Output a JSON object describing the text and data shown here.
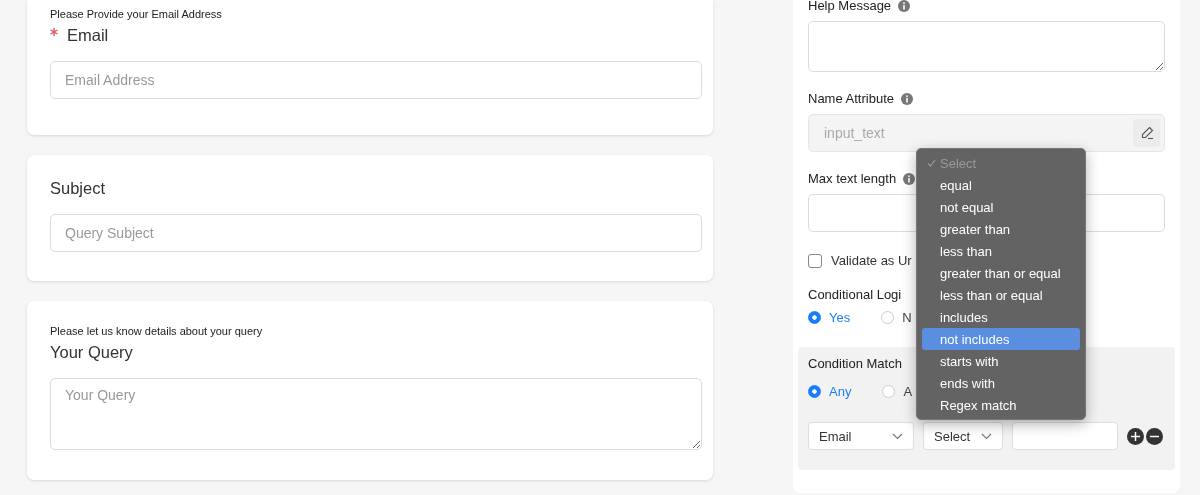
{
  "form_cards": [
    {
      "description": "Please Provide your Email Address",
      "label": "Email",
      "required": true,
      "field": {
        "kind": "input",
        "placeholder": "Email Address"
      }
    },
    {
      "label": "Subject",
      "required": false,
      "field": {
        "kind": "input",
        "placeholder": "Query Subject"
      }
    },
    {
      "description": "Please let us know details about your query",
      "label": "Your Query",
      "required": false,
      "field": {
        "kind": "textarea",
        "placeholder": "Your Query"
      }
    }
  ],
  "settings": {
    "help_message": {
      "label": "Help Message"
    },
    "name_attribute": {
      "label": "Name Attribute",
      "value": "input_text"
    },
    "max_text_length": {
      "label": "Max text length"
    },
    "validate_checkbox": {
      "label": "Validate as Ur",
      "checked": false
    },
    "conditional_logic": {
      "label": "Conditional Logi",
      "options": [
        {
          "label": "Yes",
          "selected": true
        },
        {
          "label": "N",
          "selected": false
        }
      ]
    },
    "condition_match": {
      "label": "Condition Match",
      "options": [
        {
          "label": "Any",
          "selected": true
        },
        {
          "label": "A",
          "selected": false
        }
      ],
      "rule": {
        "field": "Email",
        "operator": "Select"
      }
    }
  },
  "operator_dropdown": {
    "items": [
      {
        "label": "Select",
        "checked": true,
        "disabled": true,
        "selected": false
      },
      {
        "label": "equal",
        "checked": false,
        "disabled": false,
        "selected": false
      },
      {
        "label": "not equal",
        "checked": false,
        "disabled": false,
        "selected": false
      },
      {
        "label": "greater than",
        "checked": false,
        "disabled": false,
        "selected": false
      },
      {
        "label": "less than",
        "checked": false,
        "disabled": false,
        "selected": false
      },
      {
        "label": "greater than or equal",
        "checked": false,
        "disabled": false,
        "selected": false
      },
      {
        "label": "less than or equal",
        "checked": false,
        "disabled": false,
        "selected": false
      },
      {
        "label": "includes",
        "checked": false,
        "disabled": false,
        "selected": false
      },
      {
        "label": "not includes",
        "checked": false,
        "disabled": false,
        "selected": true
      },
      {
        "label": "starts with",
        "checked": false,
        "disabled": false,
        "selected": false
      },
      {
        "label": "ends with",
        "checked": false,
        "disabled": false,
        "selected": false
      },
      {
        "label": "Regex match",
        "checked": false,
        "disabled": false,
        "selected": false
      }
    ]
  }
}
